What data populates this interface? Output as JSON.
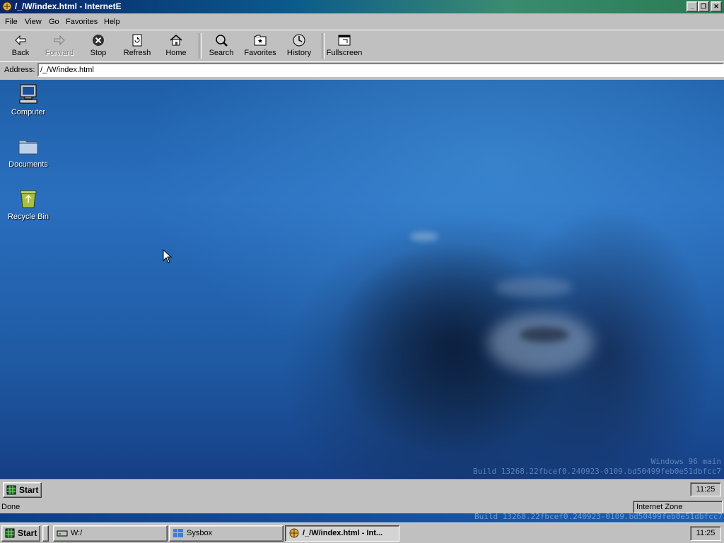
{
  "window": {
    "title": "/_/W/index.html - InternetE"
  },
  "menu": [
    "File",
    "View",
    "Go",
    "Favorites",
    "Help"
  ],
  "toolbar": {
    "back": "Back",
    "forward": "Forward",
    "stop": "Stop",
    "refresh": "Refresh",
    "home": "Home",
    "search": "Search",
    "favorites": "Favorites",
    "history": "History",
    "fullscreen": "Fullscreen"
  },
  "address": {
    "label": "Address:",
    "value": "/_/W/index.html"
  },
  "desktop": {
    "icons": [
      {
        "label": "Computer",
        "icon": "computer-icon"
      },
      {
        "label": "Documents",
        "icon": "folder-icon"
      },
      {
        "label": "Recycle Bin",
        "icon": "recycle-bin-icon"
      }
    ],
    "watermark_line1": "Windows 96 main",
    "watermark_line2": "Build 13268.22fbcef0.240923-0109.bd50499feb0e51dbfcc7"
  },
  "inner_taskbar": {
    "start": "Start",
    "clock": "11:25"
  },
  "status": {
    "text": "Done",
    "zone": "Internet Zone"
  },
  "strip_text": "Build 13268.22fbcef0.240923-0109.bd50499feb0e51dbfcc7",
  "outer_taskbar": {
    "start": "Start",
    "tasks": [
      {
        "label": "W:/",
        "icon": "drive-icon"
      },
      {
        "label": "Sysbox",
        "icon": "windows-logo-icon"
      },
      {
        "label": "/_/W/index.html - Int...",
        "icon": "browser-icon"
      }
    ],
    "clock": "11:25"
  }
}
